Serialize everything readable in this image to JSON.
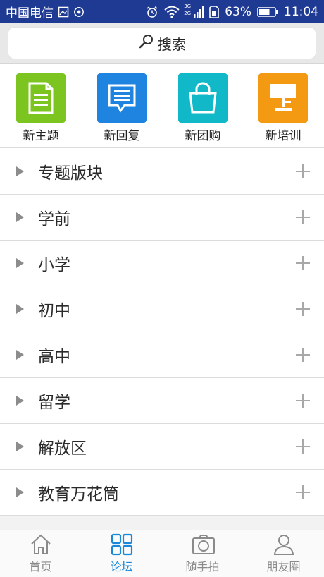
{
  "status_bar": {
    "carrier": "中国电信",
    "battery": "63%",
    "time": "11:04",
    "network_top": "3G",
    "network_bottom": "2G"
  },
  "search": {
    "label": "搜索"
  },
  "quick_actions": [
    {
      "label": "新主题",
      "icon": "document-icon",
      "color": "#7cc520"
    },
    {
      "label": "新回复",
      "icon": "reply-bubble-icon",
      "color": "#1f84e0"
    },
    {
      "label": "新团购",
      "icon": "shopping-bag-icon",
      "color": "#11b9c8"
    },
    {
      "label": "新培训",
      "icon": "lamp-icon",
      "color": "#f39a12"
    }
  ],
  "categories": [
    {
      "label": "专题版块"
    },
    {
      "label": "学前"
    },
    {
      "label": "小学"
    },
    {
      "label": "初中"
    },
    {
      "label": "高中"
    },
    {
      "label": "留学"
    },
    {
      "label": "解放区"
    },
    {
      "label": "教育万花筒"
    }
  ],
  "bottom_nav": [
    {
      "label": "首页",
      "icon": "home-icon",
      "active": false
    },
    {
      "label": "论坛",
      "icon": "grid-icon",
      "active": true
    },
    {
      "label": "随手拍",
      "icon": "camera-icon",
      "active": false
    },
    {
      "label": "朋友圈",
      "icon": "person-icon",
      "active": false
    }
  ],
  "colors": {
    "status_bar": "#1f3a93",
    "active_tab": "#1a88d8",
    "inactive_tab": "#8a8a8a"
  }
}
